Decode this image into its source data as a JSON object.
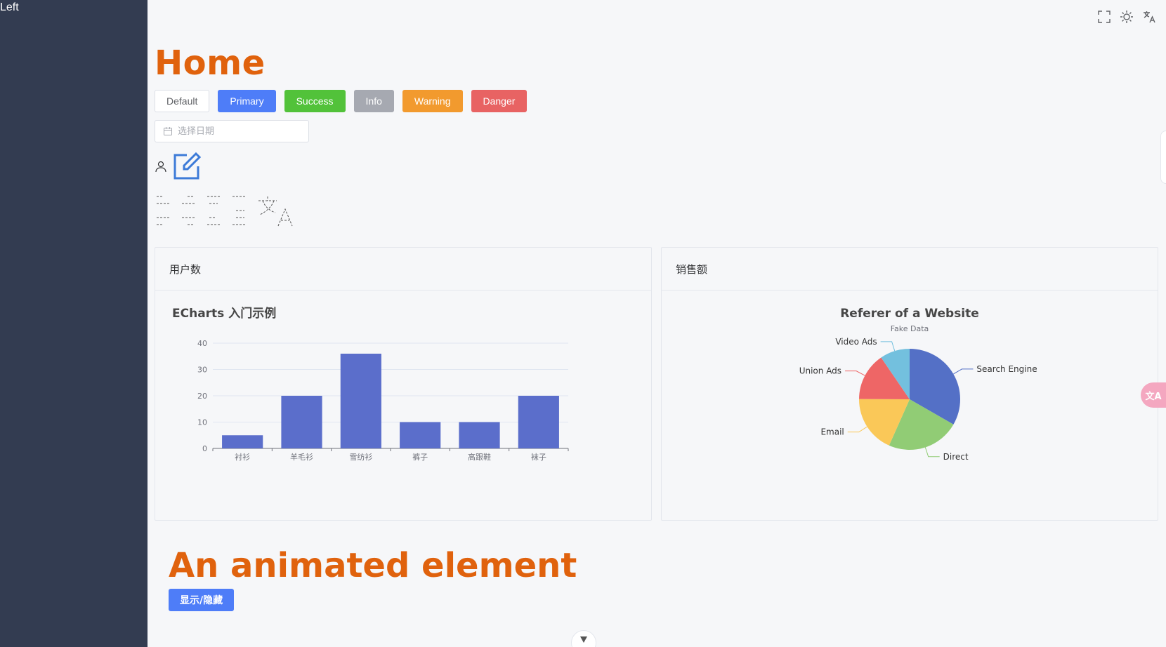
{
  "sidebar": {
    "label": "Left"
  },
  "toolbar": {
    "fullscreen_icon": "fullscreen-icon",
    "theme_icon": "sun-icon",
    "language_icon": "translate-icon"
  },
  "page": {
    "title": "Home"
  },
  "buttons": {
    "default": "Default",
    "primary": "Primary",
    "success": "Success",
    "info": "Info",
    "warning": "Warning",
    "danger": "Danger"
  },
  "date_picker": {
    "placeholder": "选择日期"
  },
  "cards": {
    "users": {
      "header": "用户数"
    },
    "sales": {
      "header": "销售额"
    }
  },
  "animated": {
    "title": "An animated element",
    "toggle_label": "显示/隐藏"
  },
  "floating": {
    "translate_badge": "文A"
  },
  "colors": {
    "accent_orange": "#e0620d",
    "sidebar_bg": "#333c51",
    "primary": "#4e7df8",
    "success": "#52c23a",
    "info": "#a6a9b1",
    "warning": "#f29a2e",
    "danger": "#e86363",
    "bar_fill": "#5b6ecb"
  },
  "chart_data": [
    {
      "type": "bar",
      "title": "ECharts 入门示例",
      "categories": [
        "衬衫",
        "羊毛衫",
        "雪纺衫",
        "裤子",
        "高跟鞋",
        "袜子"
      ],
      "values": [
        5,
        20,
        36,
        10,
        10,
        20
      ],
      "yticks": [
        0,
        10,
        20,
        30,
        40
      ],
      "ylim": [
        0,
        40
      ],
      "grid": true
    },
    {
      "type": "pie",
      "title": "Referer of a Website",
      "subtitle": "Fake Data",
      "slices": [
        {
          "name": "Search Engine",
          "value": 1048,
          "color": "#5470c6"
        },
        {
          "name": "Direct",
          "value": 735,
          "color": "#91cc75"
        },
        {
          "name": "Email",
          "value": 580,
          "color": "#fac858"
        },
        {
          "name": "Union Ads",
          "value": 484,
          "color": "#ee6666"
        },
        {
          "name": "Video Ads",
          "value": 300,
          "color": "#73c0de"
        }
      ]
    }
  ]
}
